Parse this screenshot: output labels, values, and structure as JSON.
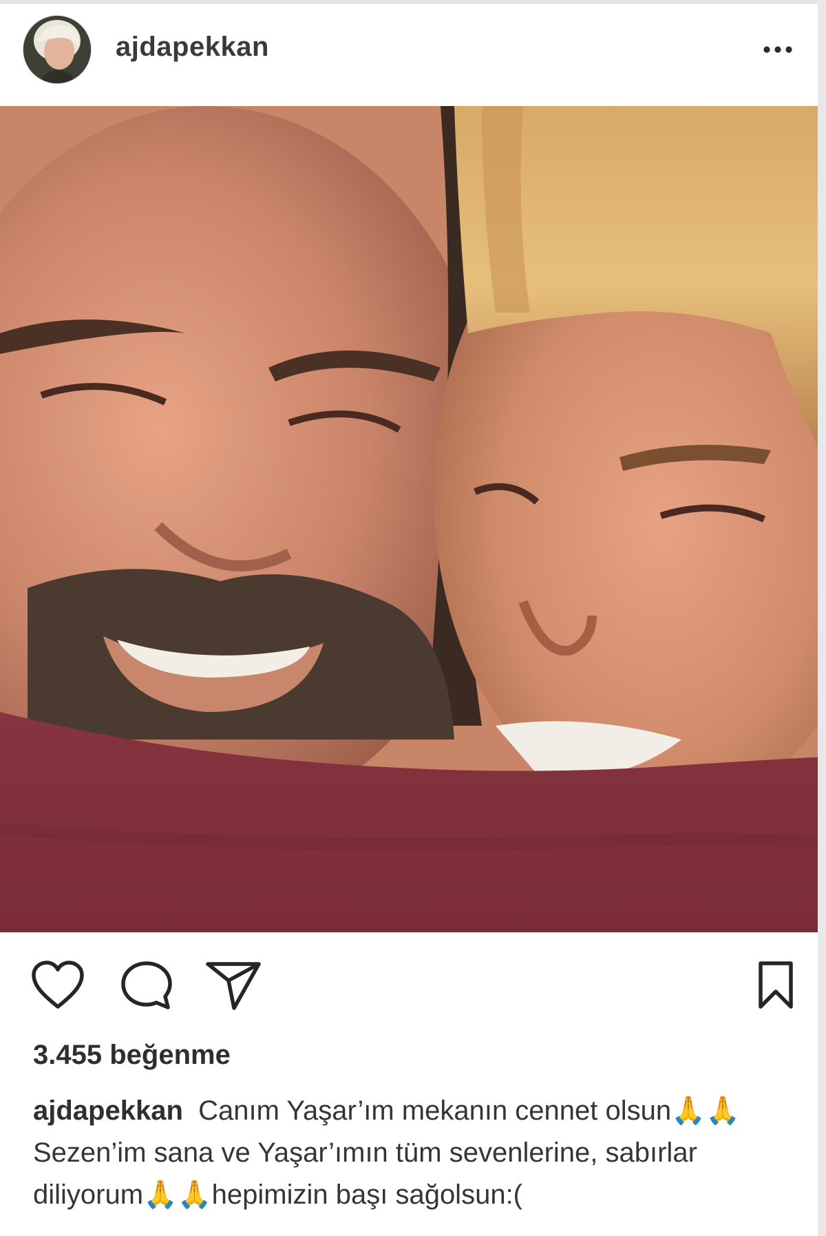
{
  "post": {
    "username": "ajdapekkan",
    "likes": "3.455 beğenme",
    "caption": {
      "username": "ajdapekkan",
      "text": "Canım Yaşar’ım mekanın cennet olsun🙏🙏 Sezen’im sana ve Yaşar’ımın tüm sevenlerine, sabırlar diliyorum🙏🙏hepimizin başı sağolsun:("
    }
  },
  "icons": {
    "more": "more-horizontal-icon",
    "like": "heart-icon",
    "comment": "comment-icon",
    "share": "send-icon",
    "save": "bookmark-icon"
  }
}
